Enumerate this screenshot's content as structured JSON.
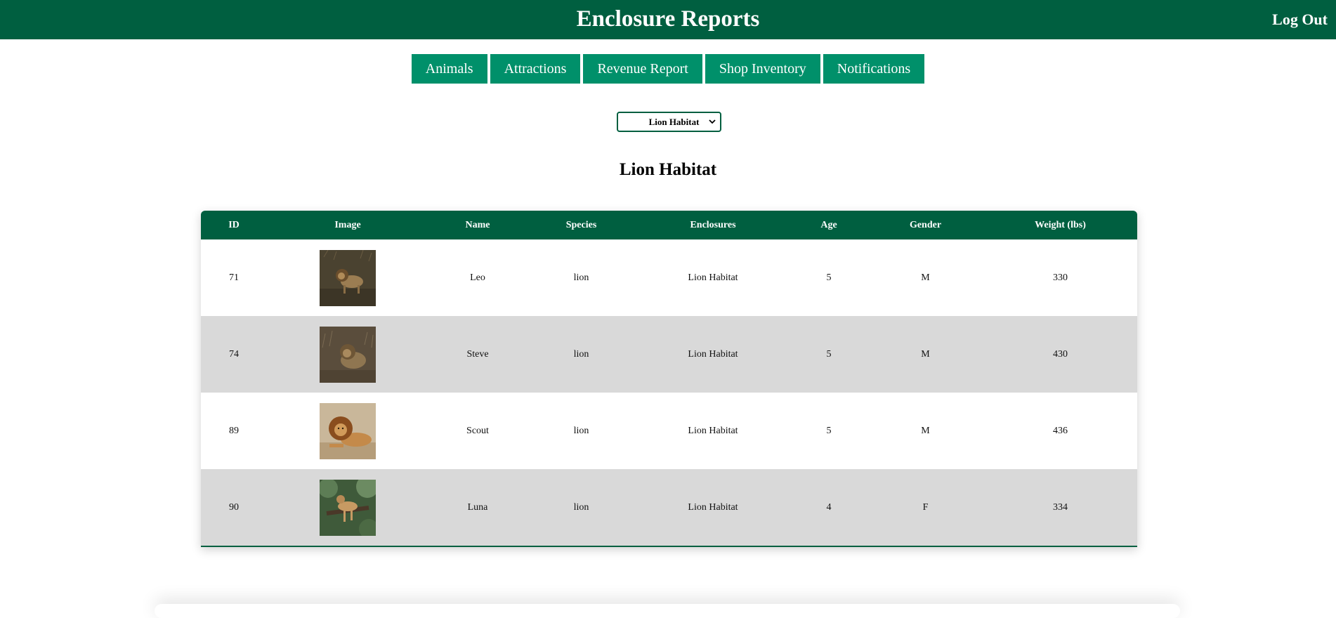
{
  "header": {
    "title": "Enclosure Reports",
    "logout_label": "Log Out",
    "bg_color": "#005f40"
  },
  "nav": {
    "items": [
      "Animals",
      "Attractions",
      "Revenue Report",
      "Shop Inventory",
      "Notifications"
    ],
    "button_color": "#00906a"
  },
  "enclosure_select": {
    "selected": "Lion Habitat"
  },
  "section_title": "Lion Habitat",
  "table": {
    "columns": [
      "ID",
      "Image",
      "Name",
      "Species",
      "Enclosures",
      "Age",
      "Gender",
      "Weight (lbs)"
    ],
    "rows": [
      {
        "id": "71",
        "image": "lion-photo-standing",
        "name": "Leo",
        "species": "lion",
        "enclosure": "Lion Habitat",
        "age": "5",
        "gender": "M",
        "weight": "330"
      },
      {
        "id": "74",
        "image": "lion-photo-grass",
        "name": "Steve",
        "species": "lion",
        "enclosure": "Lion Habitat",
        "age": "5",
        "gender": "M",
        "weight": "430"
      },
      {
        "id": "89",
        "image": "lion-photo-lying",
        "name": "Scout",
        "species": "lion",
        "enclosure": "Lion Habitat",
        "age": "5",
        "gender": "M",
        "weight": "436"
      },
      {
        "id": "90",
        "image": "lioness-photo-tree",
        "name": "Luna",
        "species": "lion",
        "enclosure": "Lion Habitat",
        "age": "4",
        "gender": "F",
        "weight": "334"
      }
    ]
  }
}
